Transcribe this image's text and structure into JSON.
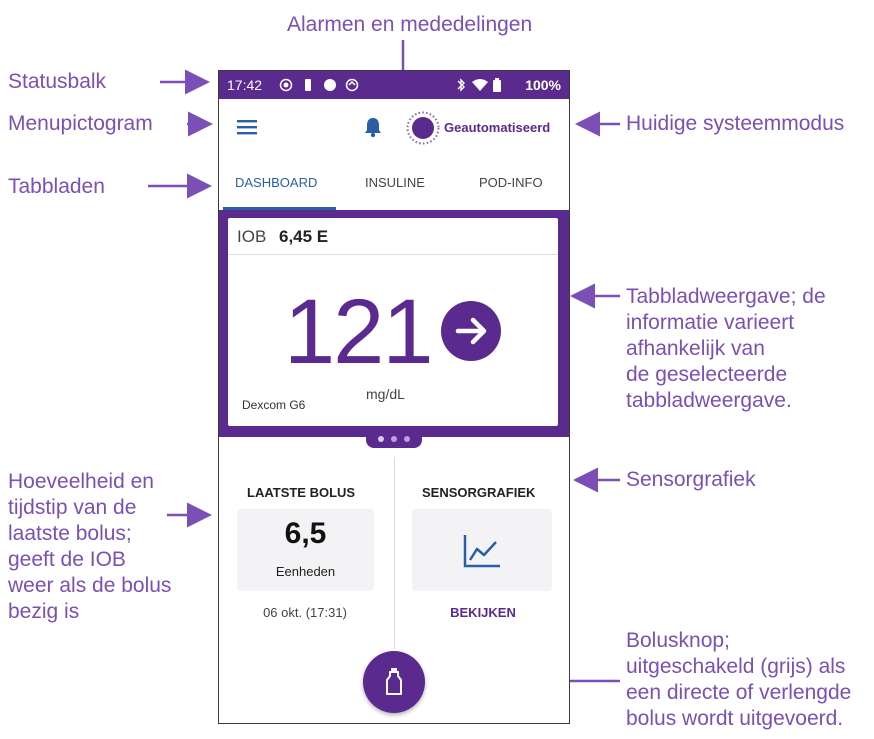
{
  "annotations": {
    "alarms": "Alarmen en mededelingen",
    "statusbar": "Statusbalk",
    "menu_icon": "Menupictogram",
    "tabs": "Tabbladen",
    "system_mode": "Huidige systeemmodus",
    "tab_view": [
      "Tabbladweergave; de",
      "informatie varieert",
      "afhankelijk van",
      "de geselecteerde",
      "tabbladweergave."
    ],
    "sensor_graph": "Sensorgrafiek",
    "last_bolus": [
      "Hoeveelheid en",
      "tijdstip van de",
      "laatste bolus;",
      "geeft de IOB",
      "weer als de bolus",
      "bezig is"
    ],
    "bolus_button": [
      "Bolusknop;",
      "uitgeschakeld (grijs) als",
      "een directe of verlengde",
      "bolus wordt uitgevoerd."
    ]
  },
  "statusbar": {
    "time": "17:42",
    "battery_percent": "100%"
  },
  "appbar": {
    "mode_label": "Geautomatiseerd"
  },
  "tabs": [
    "DASHBOARD",
    "INSULINE",
    "POD-INFO"
  ],
  "dashboard": {
    "iob_label": "IOB",
    "iob_value": "6,45 E",
    "glucose_value": "121",
    "glucose_unit": "mg/dL",
    "sensor_name": "Dexcom G6"
  },
  "last_bolus": {
    "title": "LAATSTE BOLUS",
    "amount": "6,5",
    "unit": "Eenheden",
    "time": "06 okt. (17:31)"
  },
  "sensor_graph": {
    "title": "SENSORGRAFIEK",
    "view_label": "BEKIJKEN"
  },
  "colors": {
    "brand_purple": "#5b2a8e",
    "annotation_purple": "#7b4fb5",
    "tab_active_blue": "#2a5fa8"
  },
  "icons": [
    "menu-icon",
    "bell-icon",
    "automated-mode-icon",
    "trend-arrow-right-icon",
    "line-graph-icon",
    "bolus-icon"
  ]
}
